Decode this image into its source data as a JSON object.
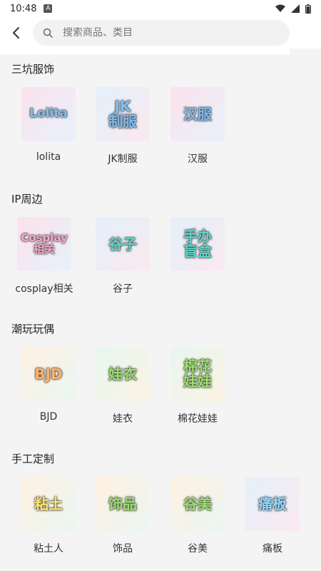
{
  "status_bar": {
    "time": "10:48",
    "notification": "A"
  },
  "search": {
    "placeholder": "搜索商品、类目"
  },
  "sections": [
    {
      "title": "三坑服饰",
      "items": [
        {
          "label": "lolita",
          "thumb_text": "Lolita"
        },
        {
          "label": "JK制服",
          "thumb_text": "JK\n制服"
        },
        {
          "label": "汉服",
          "thumb_text": "汉服"
        }
      ]
    },
    {
      "title": "IP周边",
      "items": [
        {
          "label": "cosplay相关",
          "thumb_text": "Cosplay\n相关"
        },
        {
          "label": "谷子",
          "thumb_text": "谷子"
        },
        {
          "label": "",
          "thumb_text": "手办\n盲盒"
        }
      ]
    },
    {
      "title": "潮玩玩偶",
      "items": [
        {
          "label": "BJD",
          "thumb_text": "BJD"
        },
        {
          "label": "娃衣",
          "thumb_text": "娃衣"
        },
        {
          "label": "棉花娃娃",
          "thumb_text": "棉花\n娃娃"
        }
      ]
    },
    {
      "title": "手工定制",
      "items": [
        {
          "label": "粘土人",
          "thumb_text": "粘土"
        },
        {
          "label": "饰品",
          "thumb_text": "饰品"
        },
        {
          "label": "谷美",
          "thumb_text": "谷美"
        },
        {
          "label": "痛板",
          "thumb_text": "痛板"
        }
      ]
    }
  ]
}
